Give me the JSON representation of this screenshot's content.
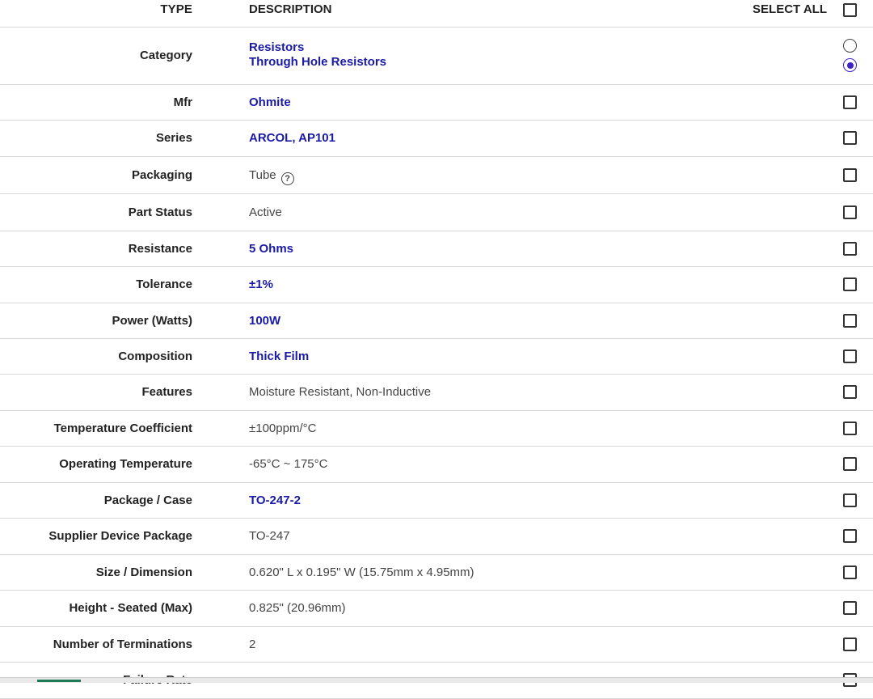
{
  "header": {
    "type_label": "TYPE",
    "description_label": "DESCRIPTION",
    "select_all_label": "SELECT ALL"
  },
  "category": {
    "label": "Category",
    "values": [
      "Resistors",
      "Through Hole Resistors"
    ]
  },
  "rows": [
    {
      "label": "Mfr",
      "value": "Ohmite",
      "link": true
    },
    {
      "label": "Series",
      "value": "ARCOL, AP101",
      "link": true
    },
    {
      "label": "Packaging",
      "value": "Tube",
      "link": false,
      "help": "?"
    },
    {
      "label": "Part Status",
      "value": "Active",
      "link": false
    },
    {
      "label": "Resistance",
      "value": "5 Ohms",
      "link": true
    },
    {
      "label": "Tolerance",
      "value": "±1%",
      "link": true
    },
    {
      "label": "Power (Watts)",
      "value": "100W",
      "link": true
    },
    {
      "label": "Composition",
      "value": "Thick Film",
      "link": true
    },
    {
      "label": "Features",
      "value": "Moisture Resistant, Non-Inductive",
      "link": false
    },
    {
      "label": "Temperature Coefficient",
      "value": "±100ppm/°C",
      "link": false
    },
    {
      "label": "Operating Temperature",
      "value": "-65°C ~ 175°C",
      "link": false
    },
    {
      "label": "Package / Case",
      "value": "TO-247-2",
      "link": true
    },
    {
      "label": "Supplier Device Package",
      "value": "TO-247",
      "link": false
    },
    {
      "label": "Size / Dimension",
      "value": "0.620\" L x 0.195\" W (15.75mm x 4.95mm)",
      "link": false
    },
    {
      "label": "Height - Seated (Max)",
      "value": "0.825\" (20.96mm)",
      "link": false
    },
    {
      "label": "Number of Terminations",
      "value": "2",
      "link": false
    },
    {
      "label": "Failure Rate",
      "value": "-",
      "link": false
    }
  ],
  "colors": {
    "link": "#1a1aa6",
    "radio_selected": "#3d22c4",
    "divider": "#d8d8d8"
  },
  "icons": {
    "packaging_help": "help-circle-icon"
  }
}
